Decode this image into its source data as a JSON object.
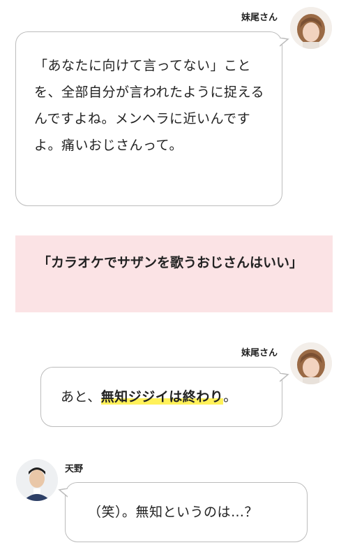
{
  "messages": [
    {
      "speaker": "妹尾さん",
      "text": "「あなたに向けて言ってない」ことを、全部自分が言われたように捉えるんですよね。メンヘラに近いんですよ。痛いおじさんって。"
    },
    {
      "speaker": "妹尾さん",
      "text_before": "あと、",
      "text_marked": "無知ジジイは終わり",
      "text_after": "。"
    },
    {
      "speaker": "天野",
      "text": "（笑）。無知というのは…？"
    }
  ],
  "headline": "「カラオケでサザンを歌うおじさんはいい」",
  "colors": {
    "headline_bg": "#fbe3e5",
    "marker": "#fff15a",
    "bubble_border": "#bcbcbc"
  }
}
